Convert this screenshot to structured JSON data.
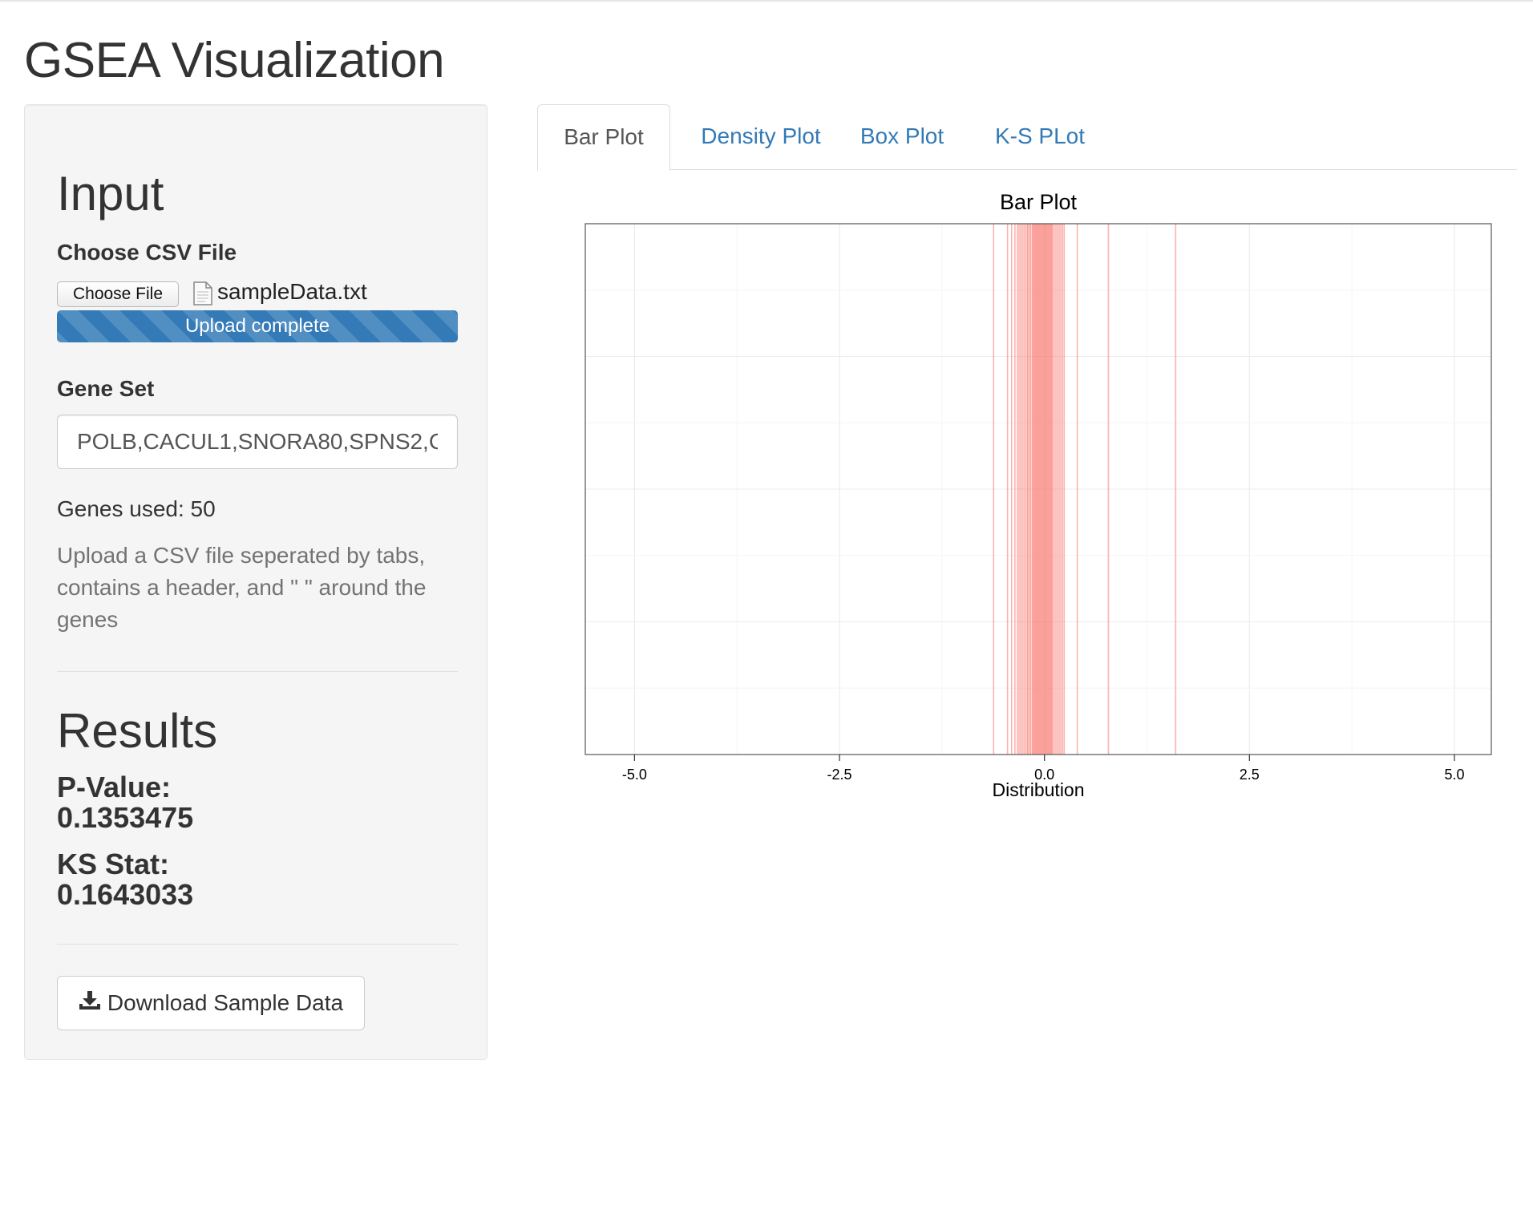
{
  "page": {
    "title": "GSEA Visualization"
  },
  "sidebar": {
    "input_heading": "Input",
    "csv_label": "Choose CSV File",
    "choose_file_label": "Choose File",
    "file_name": "sampleData.txt",
    "upload_status": "Upload complete",
    "upload_progress_percent": 100,
    "gene_set_label": "Gene Set",
    "gene_set_value": "POLB,CACUL1,SNORA80,SPNS2,C",
    "genes_used": "Genes used: 50",
    "help_text": "Upload a CSV file seperated by tabs, contains a header, and \" \" around the genes",
    "results_heading": "Results",
    "p_value_label": "P-Value:",
    "p_value": "0.1353475",
    "ks_stat_label": "KS Stat:",
    "ks_stat": "0.1643033",
    "download_label": "Download Sample Data"
  },
  "tabs": [
    {
      "label": "Bar Plot",
      "active": true
    },
    {
      "label": "Density Plot",
      "active": false
    },
    {
      "label": "Box Plot",
      "active": false
    },
    {
      "label": "K-S PLot",
      "active": false
    }
  ],
  "colors": {
    "accent": "#337ab7",
    "bar_line": "#f8766d",
    "sidebar_bg": "#f5f5f5",
    "help_text": "#737373"
  },
  "chart_data": {
    "type": "bar",
    "title": "Bar Plot",
    "xlabel": "Distribution",
    "ylabel": "",
    "xlim": [
      -5.6,
      5.45
    ],
    "xticks": [
      -5.0,
      -2.5,
      0.0,
      2.5,
      5.0
    ],
    "tick_labels": [
      "-5.0",
      "-2.5",
      "0.0",
      "2.5",
      "5.0"
    ],
    "grid": true,
    "legend": "none",
    "x": [
      -0.62,
      -0.45,
      -0.4,
      -0.36,
      -0.33,
      -0.31,
      -0.29,
      -0.27,
      -0.25,
      -0.23,
      -0.21,
      -0.2,
      -0.18,
      -0.17,
      -0.15,
      -0.14,
      -0.13,
      -0.12,
      -0.11,
      -0.1,
      -0.09,
      -0.08,
      -0.07,
      -0.06,
      -0.05,
      -0.04,
      -0.03,
      -0.02,
      -0.01,
      0.0,
      0.01,
      0.02,
      0.03,
      0.04,
      0.05,
      0.06,
      0.07,
      0.08,
      0.09,
      0.1,
      0.12,
      0.14,
      0.16,
      0.18,
      0.2,
      0.22,
      0.24,
      0.4,
      0.78,
      1.6
    ]
  }
}
